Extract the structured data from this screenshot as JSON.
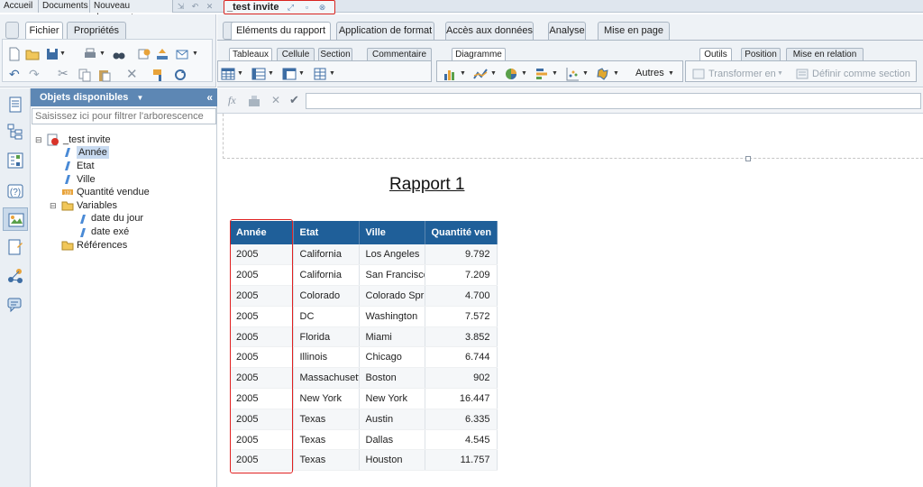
{
  "docbar": {
    "tabs": [
      "Accueil",
      "Documents",
      "Nouveau document"
    ],
    "active_doc": "_test invite"
  },
  "left_toolbar": {
    "tabs": [
      "Fichier",
      "Propriétés"
    ]
  },
  "ribbon": {
    "tabs": [
      "Eléments du rapport",
      "Application de format",
      "Accès aux données",
      "Analyse",
      "Mise en page"
    ],
    "subtabs_left": [
      "Tableaux",
      "Cellule",
      "Section",
      "Commentaire"
    ],
    "subtab_chart": "Diagramme",
    "chart_more": "Autres",
    "subtabs_right": [
      "Outils",
      "Position",
      "Mise en relation"
    ],
    "transform_label": "Transformer en",
    "define_section_label": "Définir comme section"
  },
  "objects_panel": {
    "title": "Objets disponibles",
    "filter_placeholder": "Saisissez ici pour filtrer l'arborescence",
    "root": "_test invite",
    "items": [
      "Année",
      "Etat",
      "Ville",
      "Quantité vendue"
    ],
    "variables_label": "Variables",
    "variables": [
      "date du jour",
      "date exé"
    ],
    "references_label": "Références"
  },
  "report": {
    "title": "Rapport 1",
    "columns": [
      "Année",
      "Etat",
      "Ville",
      "Quantité ven"
    ],
    "rows": [
      [
        "2005",
        "California",
        "Los Angeles",
        "9.792"
      ],
      [
        "2005",
        "California",
        "San Francisco",
        "7.209"
      ],
      [
        "2005",
        "Colorado",
        "Colorado Springs",
        "4.700"
      ],
      [
        "2005",
        "DC",
        "Washington",
        "7.572"
      ],
      [
        "2005",
        "Florida",
        "Miami",
        "3.852"
      ],
      [
        "2005",
        "Illinois",
        "Chicago",
        "6.744"
      ],
      [
        "2005",
        "Massachusetts",
        "Boston",
        "902"
      ],
      [
        "2005",
        "New York",
        "New York",
        "16.447"
      ],
      [
        "2005",
        "Texas",
        "Austin",
        "6.335"
      ],
      [
        "2005",
        "Texas",
        "Dallas",
        "4.545"
      ],
      [
        "2005",
        "Texas",
        "Houston",
        "11.757"
      ]
    ]
  },
  "colors": {
    "table_header": "#1f5f99",
    "panel_header": "#5d87b4",
    "highlight": "#e02020"
  }
}
